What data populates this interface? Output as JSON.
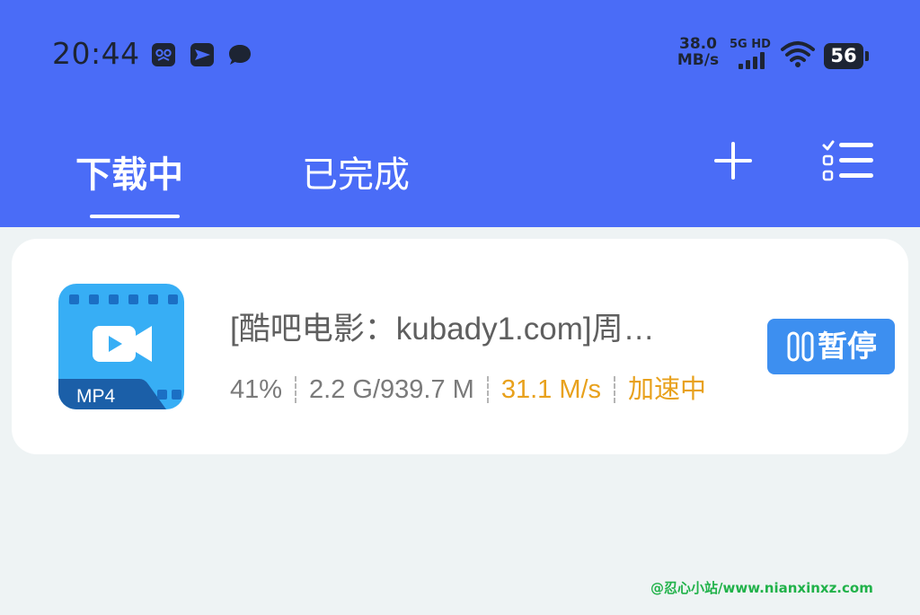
{
  "status_bar": {
    "time": "20:44",
    "notification_icons": [
      "robot-app-icon",
      "paper-plane-app-icon",
      "chat-bubble-icon"
    ],
    "net_speed_value": "38.0",
    "net_speed_unit": "MB/s",
    "signal_label": "5G HD",
    "battery": "56"
  },
  "header": {
    "tabs": [
      {
        "label": "下载中",
        "active": true
      },
      {
        "label": "已完成",
        "active": false
      }
    ],
    "add_icon": "plus-icon",
    "menu_icon": "checklist-menu-icon",
    "background_color": "#4a6cf7"
  },
  "download": {
    "file_type": "MP4",
    "title": "[酷吧电影：kubady1.com]周…",
    "progress_percent": "41%",
    "size": "2.2 G/939.7 M",
    "speed": "31.1 M/s",
    "status": "加速中",
    "pause_label": "暂停",
    "accent_color": "#e8a11c",
    "button_color": "#3d8ff0"
  },
  "watermark": "@忍心小站/www.nianxinxz.com"
}
